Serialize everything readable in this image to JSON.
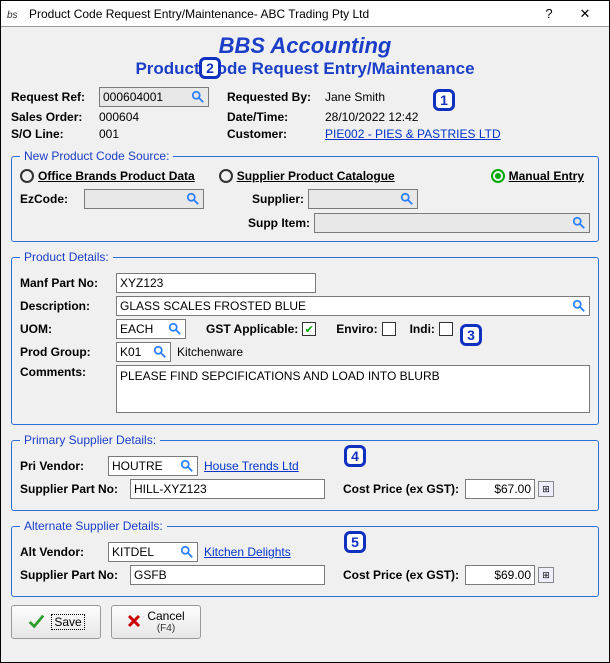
{
  "window": {
    "title": "Product Code Request Entry/Maintenance- ABC Trading Pty Ltd"
  },
  "heading": {
    "h1": "BBS Accounting",
    "h2": "Product Code Request Entry/Maintenance"
  },
  "header": {
    "request_ref_label": "Request Ref:",
    "request_ref": "000604001",
    "requested_by_label": "Requested By:",
    "requested_by": "Jane Smith",
    "sales_order_label": "Sales Order:",
    "sales_order": "000604",
    "datetime_label": "Date/Time:",
    "datetime": "28/10/2022 12:42",
    "so_line_label": "S/O Line:",
    "so_line": "001",
    "customer_label": "Customer:",
    "customer_link": "PIE002 - PIES & PASTRIES LTD"
  },
  "source": {
    "legend": "New Product Code Source:",
    "opt1": "Office Brands Product Data",
    "opt2": "Supplier Product Catalogue",
    "opt3": "Manual Entry",
    "ezcode_label": "EzCode:",
    "ezcode": "",
    "supplier_label": "Supplier:",
    "supplier": "",
    "supp_item_label": "Supp Item:",
    "supp_item": ""
  },
  "product": {
    "legend": "Product Details:",
    "manf_label": "Manf Part No:",
    "manf": "XYZ123",
    "desc_label": "Description:",
    "desc": "GLASS SCALES FROSTED BLUE",
    "uom_label": "UOM:",
    "uom": "EACH",
    "gst_label": "GST Applicable:",
    "enviro_label": "Enviro:",
    "indi_label": "Indi:",
    "group_label": "Prod Group:",
    "group": "K01",
    "group_name": "Kitchenware",
    "comments_label": "Comments:",
    "comments": "PLEASE FIND SEPCIFICATIONS AND LOAD INTO BLURB"
  },
  "primary": {
    "legend": "Primary Supplier Details:",
    "vendor_label": "Pri Vendor:",
    "vendor": "HOUTRE",
    "vendor_name": "House Trends Ltd",
    "part_label": "Supplier Part No:",
    "part": "HILL-XYZ123",
    "cost_label": "Cost Price (ex GST):",
    "cost": "$67.00"
  },
  "alternate": {
    "legend": "Alternate Supplier Details:",
    "vendor_label": "Alt Vendor:",
    "vendor": "KITDEL",
    "vendor_name": "Kitchen Delights",
    "part_label": "Supplier Part No:",
    "part": "GSFB",
    "cost_label": "Cost Price (ex GST):",
    "cost": "$69.00"
  },
  "buttons": {
    "save": "Save",
    "cancel": "Cancel",
    "cancel_key": "(F4)"
  },
  "badges": {
    "b1": "1",
    "b2": "2",
    "b3": "3",
    "b4": "4",
    "b5": "5"
  }
}
